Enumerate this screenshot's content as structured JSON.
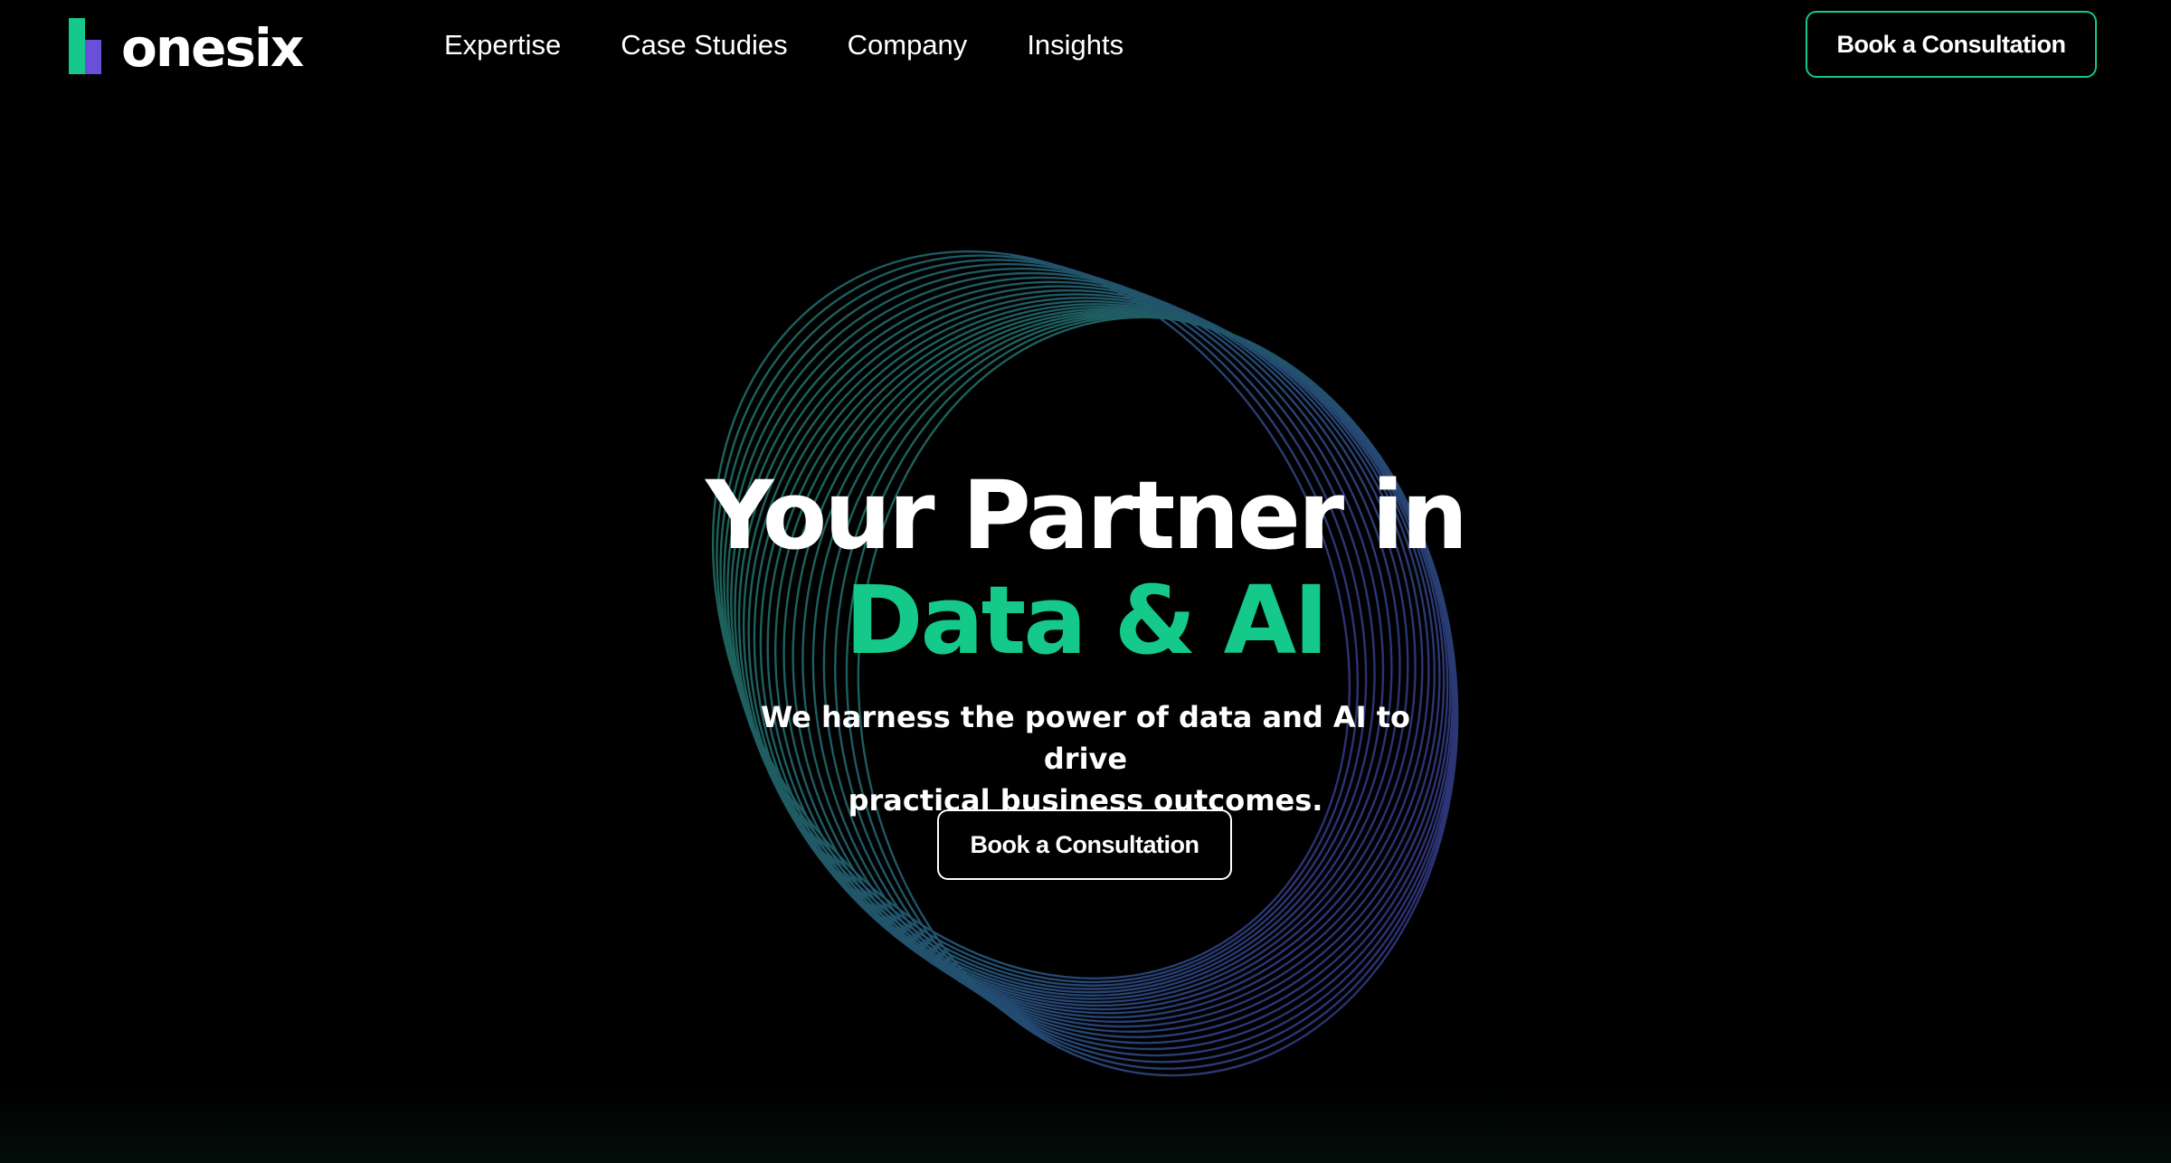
{
  "header": {
    "logo_text": "onesix",
    "nav": [
      {
        "label": "Expertise"
      },
      {
        "label": "Case Studies"
      },
      {
        "label": "Company"
      },
      {
        "label": "Insights"
      }
    ],
    "cta_label": "Book a Consultation"
  },
  "hero": {
    "title_line1": "Your Partner in",
    "title_line2": "Data & AI",
    "subtitle_line1": "We harness the power of data and AI to drive",
    "subtitle_line2": "practical business outcomes.",
    "cta_label": "Book a Consultation"
  },
  "colors": {
    "background": "#000000",
    "accent_green": "#14c98a",
    "accent_purple": "#6a4fd8",
    "text": "#ffffff"
  },
  "icons": {
    "logo_mark": "onesix-logo-mark",
    "hero_graphic": "ring-wireframe-graphic"
  }
}
